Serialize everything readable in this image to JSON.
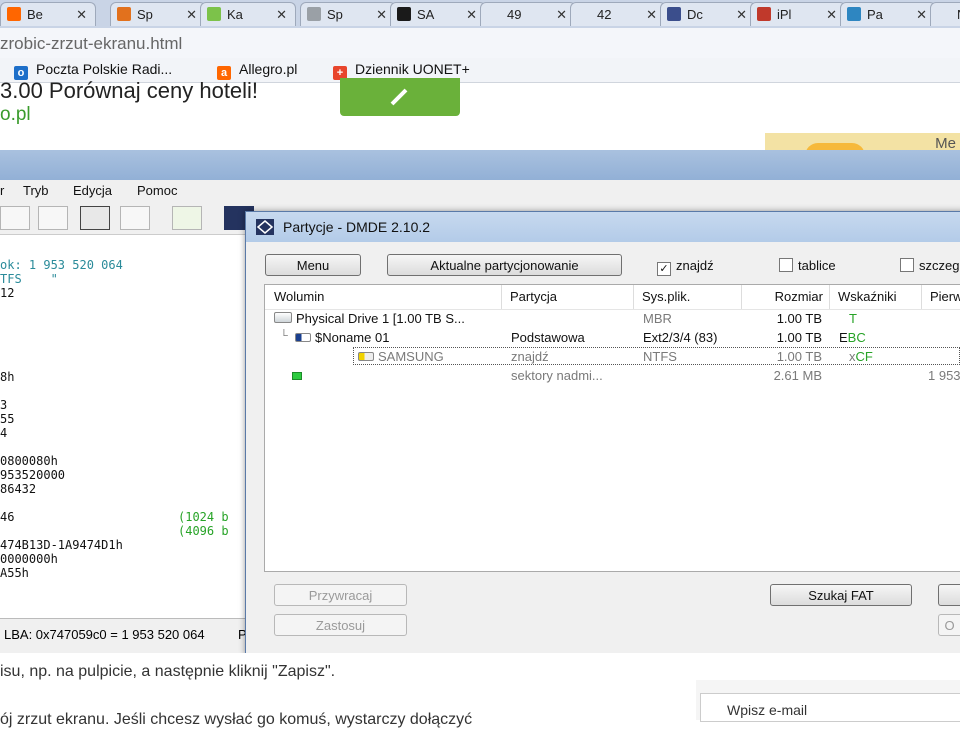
{
  "browser": {
    "tabs": [
      {
        "label": "Be",
        "color": "#ff6600"
      },
      {
        "label": "Sp",
        "color": "#e2711d"
      },
      {
        "label": "Ka",
        "color": "#7cc24a"
      },
      {
        "label": "Sp",
        "color": "#9aa0a6"
      },
      {
        "label": "SA",
        "color": "#1a1a1a"
      },
      {
        "label": "49",
        "color": "#dfe6f1"
      },
      {
        "label": "42",
        "color": "#dfe6f1"
      },
      {
        "label": "Dc",
        "color": "#3b4e8c"
      },
      {
        "label": "iPl",
        "color": "#c0392b"
      },
      {
        "label": "Pa",
        "color": "#2e86c1"
      },
      {
        "label": "N",
        "color": "#dfe6f1"
      }
    ],
    "url": "zrobic-zrzut-ekranu.html",
    "bookmarks": [
      "Poczta Polskie Radi...",
      "Allegro.pl",
      "Dziennik UONET+"
    ]
  },
  "web": {
    "ad_text": "3.00  Porównaj ceny hoteli!",
    "ad_link": "o.pl",
    "promo_text": "Me",
    "bottom_text_1": "isu, np. na pulpicie, a następnie kliknij \"Zapisz\".",
    "bottom_text_2": "ój zrzut ekranu. Jeśli chcesz wysłać go komuś, wystarczy dołączyć",
    "email_placeholder": "Wpisz e-mail"
  },
  "dmde": {
    "menu": [
      "r",
      "Tryb",
      "Edycja",
      "Pomoc"
    ],
    "hex_lines": [
      "ok: 1 953 520 064",
      "TFS    \"",
      "12",
      "",
      "",
      "",
      "",
      "8h",
      "",
      "3",
      "55",
      "4",
      "",
      "0800080h",
      "953520000",
      "86432",
      "",
      "46",
      "",
      "474B13D-1A9474D1h",
      "0000000h",
      "A55h"
    ],
    "hex_right": [
      "(1024 b",
      "(4096 b"
    ],
    "status": "LBA: 0x747059c0 = 1 953 520 064",
    "status_suffix": "P"
  },
  "dialog": {
    "title": "Partycje - DMDE 2.10.2",
    "menu_button": "Menu",
    "current_button": "Aktualne partycjonowanie",
    "checks": [
      {
        "label": "znajdź",
        "checked": true
      },
      {
        "label": "tablice",
        "checked": false
      },
      {
        "label": "szczeg",
        "checked": false
      }
    ],
    "columns": [
      "Wolumin",
      "Partycja",
      "Sys.plik.",
      "Rozmiar",
      "Wskaźniki",
      "Pierw"
    ],
    "rows": [
      {
        "volume": "Physical Drive 1 [1.00 TB S...",
        "partition": "",
        "fs": "MBR",
        "size": "1.00 TB",
        "flags_a": "",
        "flags_b": "T",
        "first": ""
      },
      {
        "volume": "$Noname 01",
        "partition": "Podstawowa",
        "fs": "Ext2/3/4 (83)",
        "size": "1.00 TB",
        "flags_a": "E",
        "flags_b": "BC",
        "first": ""
      },
      {
        "volume": "SAMSUNG",
        "partition": "znajdź",
        "fs": "NTFS",
        "size": "1.00 TB",
        "flags_a": "x",
        "flags_b": "CF",
        "first": ""
      },
      {
        "volume": "",
        "partition": "sektory nadmi...",
        "fs": "",
        "size": "2.61 MB",
        "flags_a": "",
        "flags_b": "",
        "first": "1 953"
      }
    ],
    "btn_restore": "Przywracaj",
    "btn_apply": "Zastosuj",
    "btn_search_fat": "Szukaj FAT",
    "btn_right_2": "O"
  }
}
